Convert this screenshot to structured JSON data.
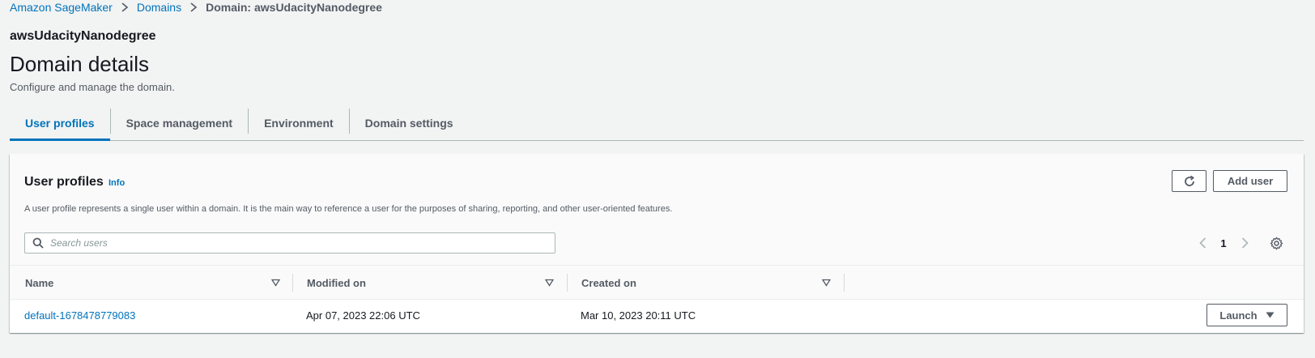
{
  "breadcrumb": {
    "items": [
      "Amazon SageMaker",
      "Domains"
    ],
    "current": "Domain: awsUdacityNanodegree"
  },
  "header": {
    "domain_name": "awsUdacityNanodegree",
    "title": "Domain details",
    "description": "Configure and manage the domain."
  },
  "tabs": [
    {
      "label": "User profiles",
      "active": true
    },
    {
      "label": "Space management",
      "active": false
    },
    {
      "label": "Environment",
      "active": false
    },
    {
      "label": "Domain settings",
      "active": false
    }
  ],
  "user_profiles": {
    "title": "User profiles",
    "info_label": "Info",
    "description": "A user profile represents a single user within a domain. It is the main way to reference a user for the purposes of sharing, reporting, and other user-oriented features.",
    "refresh_icon": "refresh-icon",
    "add_user_label": "Add user",
    "search_placeholder": "Search users",
    "search_value": "",
    "page_number": "1",
    "columns": [
      "Name",
      "Modified on",
      "Created on"
    ],
    "rows": [
      {
        "name": "default-1678478779083",
        "modified_on": "Apr 07, 2023 22:06 UTC",
        "created_on": "Mar 10, 2023 20:11 UTC",
        "action_label": "Launch"
      }
    ]
  },
  "colors": {
    "link": "#0073bb",
    "background": "#f2f3f3",
    "text": "#16191f",
    "secondary_text": "#545b64"
  }
}
